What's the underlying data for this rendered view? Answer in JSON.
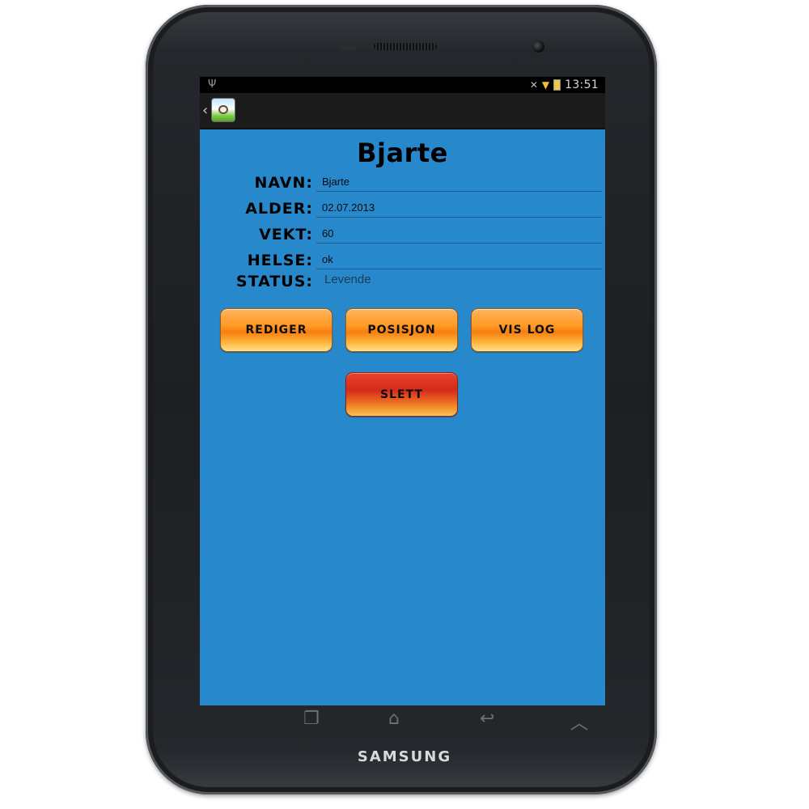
{
  "device": {
    "brand": "SAMSUNG"
  },
  "status_bar": {
    "time": "13:51",
    "icons": [
      "usb-icon",
      "mute-icon",
      "wifi-icon",
      "battery-icon"
    ]
  },
  "action_bar": {
    "back_icon": "chevron-left-icon",
    "app_icon": "cow-app-icon"
  },
  "main": {
    "title": "Bjarte",
    "fields": [
      {
        "label": "NAVN:",
        "value": "Bjarte"
      },
      {
        "label": "ALDER:",
        "value": "02.07.2013"
      },
      {
        "label": "VEKT:",
        "value": "60"
      },
      {
        "label": "HELSE:",
        "value": "ok"
      }
    ],
    "status": {
      "label": "STATUS:",
      "value": "Levende"
    },
    "buttons": {
      "edit": "REDIGER",
      "position": "POSISJON",
      "show_log": "VIS LOG",
      "delete": "SLETT"
    }
  },
  "nav_bar": {
    "icons": [
      "recent-apps-icon",
      "home-icon",
      "back-icon",
      "menu-up-icon"
    ]
  },
  "colors": {
    "content_background": "#2888cc",
    "button_orange": "#ff9a25",
    "button_red": "#d52a1c"
  }
}
